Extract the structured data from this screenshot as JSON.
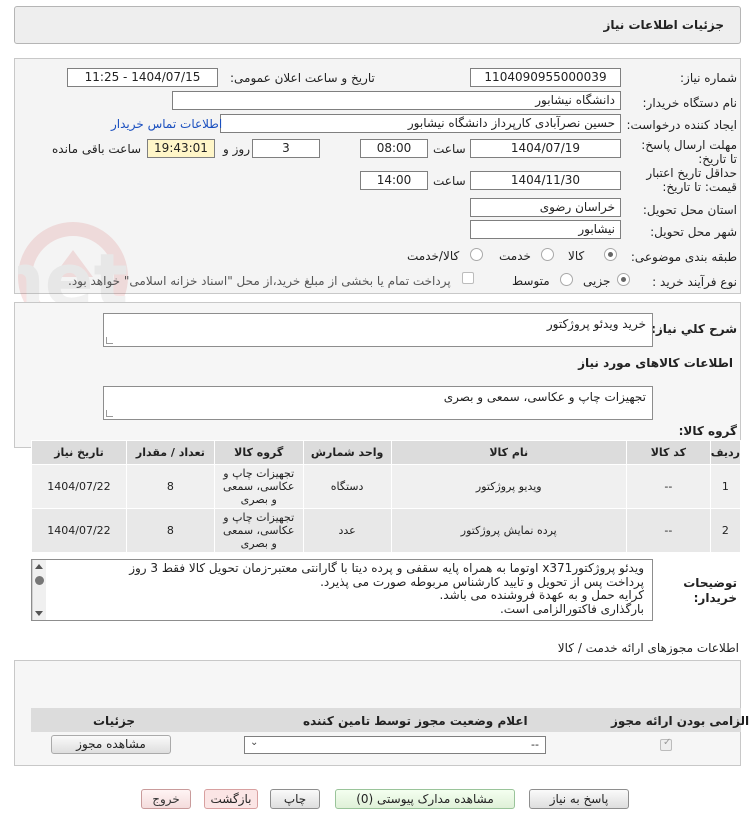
{
  "header": {
    "title": "جزئیات اطلاعات نیاز"
  },
  "watermark": {
    "text": "AriaTender.net"
  },
  "form": {
    "need_number_label": "شماره نیاز:",
    "need_number": "1104090955000039",
    "announce_label": "تاریخ و ساعت اعلان عمومی:",
    "announce_value": "1404/07/15 - 11:25",
    "buyer_org_label": "نام دستگاه خریدار:",
    "buyer_org": "دانشگاه نیشابور",
    "requester_label": "ایجاد کننده درخواست:",
    "requester": "حسین نصرآبادی کارپرداز دانشگاه نیشابور",
    "contact_link": "اطلاعات تماس خریدار",
    "reply_deadline_label": "مهلت ارسال پاسخ: تا تاریخ:",
    "reply_date": "1404/07/19",
    "time_label": "ساعت",
    "reply_time": "08:00",
    "days": "3",
    "days_and_label": "روز و",
    "countdown": "19:43:01",
    "remaining_label": "ساعت باقی مانده",
    "validity_label": "حداقل تاریخ اعتبار قیمت: تا تاریخ:",
    "validity_date": "1404/11/30",
    "validity_time": "14:00",
    "province_label": "استان محل تحویل:",
    "province": "خراسان رضوی",
    "city_label": "شهر محل تحویل:",
    "city": "نیشابور",
    "category_label": "طبقه بندی موضوعی:",
    "category_options": [
      "کالا",
      "خدمت",
      "کالا/خدمت"
    ],
    "process_label": "نوع فرآیند خرید :",
    "process_options": [
      "جزیی",
      "متوسط"
    ],
    "payment_note": "پرداخت تمام یا بخشی از مبلغ خرید،از محل \"اسناد خزانه اسلامی\" خواهد بود."
  },
  "summary": {
    "label": "شرح كلي نياز:",
    "value": "خرید ویدئو پروژکتور"
  },
  "goods_info_title": "اطلاعات کالاهای مورد نیاز",
  "goods_group": {
    "label": "گروه کالا:",
    "value": "تجهیزات چاپ و عکاسی، سمعی و بصری"
  },
  "table": {
    "headers": [
      "ردیف",
      "کد کالا",
      "نام کالا",
      "واحد شمارش",
      "گروه کالا",
      "تعداد / مقدار",
      "تاریخ نیاز"
    ],
    "rows": [
      [
        "1",
        "--",
        "ویدیو پروژکتور",
        "دستگاه",
        "تجهیزات چاپ و عکاسی، سمعی و بصری",
        "8",
        "1404/07/22"
      ],
      [
        "2",
        "--",
        "پرده نمایش پروژکتور",
        "عدد",
        "تجهیزات چاپ و عکاسی، سمعی و بصری",
        "8",
        "1404/07/22"
      ]
    ]
  },
  "buyer_notes": {
    "label": "توضیحات خریدار:",
    "lines": [
      "ویدئو پروژکتورx371 اوتوما به همراه پایه سقفی و پرده دیتا با گارانتی معتبر-زمان تحویل کالا فقط 3 روز",
      "پرداخت پس از تحویل و تایید کارشناس مربوطه صورت می پذیرد.",
      "کرایه حمل و به عهدة فروشنده می باشد.",
      "بارگذاری فاکتورالزامی است."
    ]
  },
  "permits": {
    "title": "اطلاعات مجوزهای ارائه خدمت / کالا",
    "headers": [
      "الزامی بودن ارائه مجوز",
      "اعلام وضعیت مجوز توسط تامین کننده",
      "جزئیات"
    ],
    "select_value": "--",
    "view_button": "مشاهده مجوز"
  },
  "actions": {
    "reply": "پاسخ به نیاز",
    "docs": "مشاهده مدارک پیوستی (0)",
    "print": "چاپ",
    "back": "بازگشت",
    "exit": "خروج"
  }
}
